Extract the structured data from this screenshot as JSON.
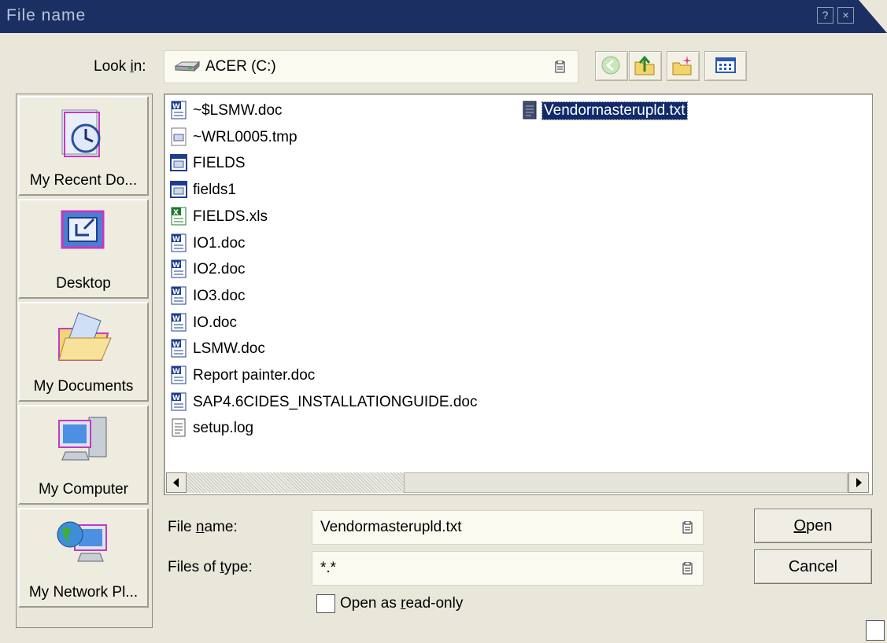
{
  "window": {
    "title": "File name",
    "help_label": "?",
    "close_label": "×"
  },
  "look_in": {
    "label_pre": "Look ",
    "label_key": "i",
    "label_post": "n:",
    "value": "ACER (C:)"
  },
  "toolbar": {
    "back": "back-icon",
    "up": "up-folder-icon",
    "new_folder": "new-folder-icon",
    "view_menu": "view-menu-icon"
  },
  "places": [
    {
      "label": "My Recent Do...",
      "icon": "recent-documents-icon"
    },
    {
      "label": "Desktop",
      "icon": "desktop-icon"
    },
    {
      "label": "My Documents",
      "icon": "my-documents-icon"
    },
    {
      "label": "My Computer",
      "icon": "my-computer-icon"
    },
    {
      "label": "My Network Pl...",
      "icon": "network-places-icon"
    }
  ],
  "files": [
    {
      "name": "~$LSMW.doc",
      "type": "word"
    },
    {
      "name": "~WRL0005.tmp",
      "type": "tmp"
    },
    {
      "name": "FIELDS",
      "type": "form"
    },
    {
      "name": "fields1",
      "type": "form"
    },
    {
      "name": "FIELDS.xls",
      "type": "excel"
    },
    {
      "name": "IO1.doc",
      "type": "word"
    },
    {
      "name": "IO2.doc",
      "type": "word"
    },
    {
      "name": "IO3.doc",
      "type": "word"
    },
    {
      "name": "IO.doc",
      "type": "word"
    },
    {
      "name": "LSMW.doc",
      "type": "word"
    },
    {
      "name": "Report painter.doc",
      "type": "word"
    },
    {
      "name": "SAP4.6CIDES_INSTALLATIONGUIDE.doc",
      "type": "word"
    },
    {
      "name": "setup.log",
      "type": "text"
    },
    {
      "name": "Vendormasterupld.txt",
      "type": "text-selected",
      "selected": true
    }
  ],
  "file_name": {
    "label_pre": "File ",
    "label_key": "n",
    "label_post": "ame:",
    "value": "Vendormasterupld.txt"
  },
  "file_type": {
    "label_pre": "Files of ",
    "label_key": "t",
    "label_post": "ype:",
    "value": "*.*"
  },
  "readonly": {
    "label_pre": "Open as ",
    "label_key": "r",
    "label_post": "ead-only",
    "checked": false
  },
  "buttons": {
    "open_key": "O",
    "open_rest": "pen",
    "cancel": "Cancel"
  }
}
